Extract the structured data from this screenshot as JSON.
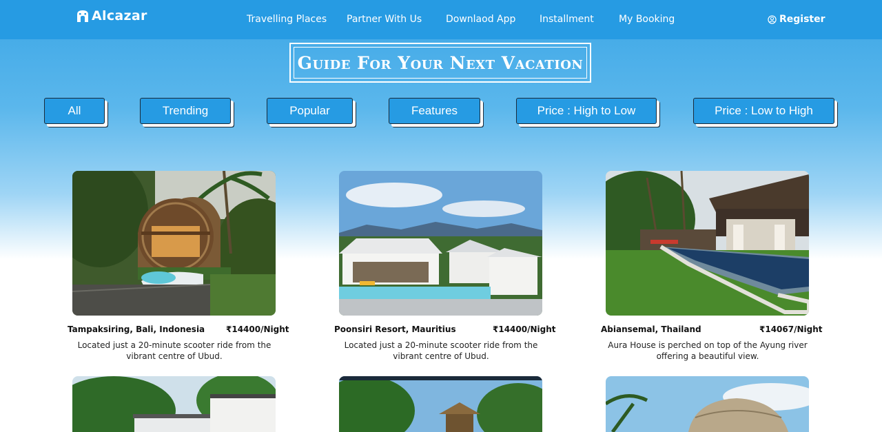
{
  "nav": {
    "brand": "Alcazar",
    "links": [
      "Travelling Places",
      "Partner With Us",
      "Downlaod App",
      "Installment",
      "My Booking"
    ],
    "register": "Register"
  },
  "hero": {
    "title": "Guide For Your Next Vacation"
  },
  "filters": [
    "All",
    "Trending",
    "Popular",
    "Features",
    "Price : High to Low",
    "Price : Low to High"
  ],
  "cards": [
    {
      "location": "Tampaksiring, Bali, Indonesia",
      "price": "₹14400/Night",
      "description": "Located just a 20-minute scooter ride from the vibrant centre of Ubud."
    },
    {
      "location": "Poonsiri Resort, Mauritius",
      "price": "₹14400/Night",
      "description": "Located just a 20-minute scooter ride from the vibrant centre of Ubud."
    },
    {
      "location": "Abiansemal, Thailand",
      "price": "₹14067/Night",
      "description": "Aura House is perched on top of the Ayung river offering a beautiful view."
    }
  ],
  "colors": {
    "nav": "#269be3",
    "button": "#269be3",
    "text": "#111111"
  }
}
